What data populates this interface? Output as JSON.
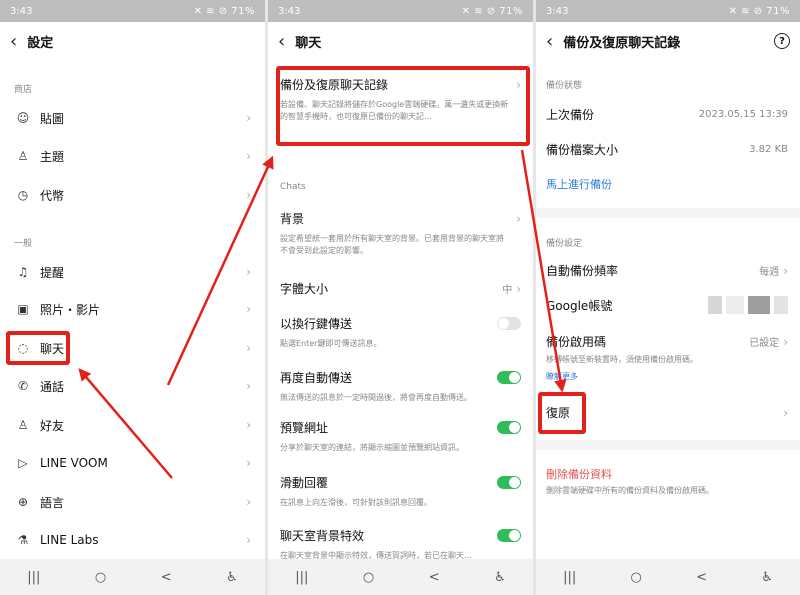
{
  "status": {
    "time": "3:43",
    "icons_left": "▣ G ⋈ •",
    "icons_right": "✕ ≋ ⊘ 71%"
  },
  "panel1": {
    "header_title": "設定",
    "section_shop": "商店",
    "shop_items": [
      {
        "icon": "☺",
        "label": "貼圖"
      },
      {
        "icon": "♙",
        "label": "主題"
      },
      {
        "icon": "◷",
        "label": "代幣"
      }
    ],
    "section_general": "一般",
    "general_items": [
      {
        "icon": "♫",
        "label": "提醒"
      },
      {
        "icon": "▣",
        "label": "照片・影片"
      },
      {
        "icon": "◌",
        "label": "聊天"
      },
      {
        "icon": "✆",
        "label": "通話"
      },
      {
        "icon": "♙",
        "label": "好友"
      },
      {
        "icon": "▷",
        "label": "LINE VOOM"
      },
      {
        "icon": "⊕",
        "label": "語言"
      },
      {
        "icon": "⚗",
        "label": "LINE Labs"
      }
    ]
  },
  "panel2": {
    "header_title": "聊天",
    "backup_title": "備份及復原聊天記錄",
    "backup_desc": "若設備、聊天記錄將儲存於Google雲端硬碟。萬一遺失或更換新的智慧手機時，也可復原已備份的聊天記...",
    "section_chats": "Chats",
    "settings": [
      {
        "title": "背景",
        "desc": "設定希望統一套用於所有聊天室的背景。已套用背景的聊天室將不會受到此設定的影響。",
        "control": "chevron"
      },
      {
        "title": "字體大小",
        "value": "中",
        "control": "chevron"
      },
      {
        "title": "以換行鍵傳送",
        "desc": "點選Enter鍵即可傳送訊息。",
        "control": "toggle-off"
      },
      {
        "title": "再度自動傳送",
        "desc": "無法傳送的訊息於一定時間過後，將會再度自動傳送。",
        "control": "toggle-on"
      },
      {
        "title": "預覽網址",
        "desc": "分享於聊天室的連結，將顯示縮圖並預覽網站資訊。",
        "control": "toggle-on"
      },
      {
        "title": "滑動回覆",
        "desc": "在訊息上向左滑後，可針對該則訊息回覆。",
        "control": "toggle-on"
      },
      {
        "title": "聊天室背景特效",
        "desc": "在聊天室背景中顯示特效，傳送賀詞時，若已在聊天...",
        "control": "toggle-on"
      }
    ]
  },
  "panel3": {
    "header_title": "備份及復原聊天記錄",
    "help": "?",
    "section_status": "備份狀態",
    "last_backup_label": "上次備份",
    "last_backup_value": "2023.05.15 13:39",
    "file_size_label": "備份檔案大小",
    "file_size_value": "3.82 KB",
    "backup_now": "馬上進行備份",
    "section_settings": "備份設定",
    "freq_label": "自動備份頻率",
    "freq_value": "每週",
    "google_label": "Google帳號",
    "pin_label": "備份啟用碼",
    "pin_value": "已設定",
    "pin_desc": "移轉帳號至新裝置時，須使用備份啟用碼。",
    "learn_more": "瞭解更多",
    "restore": "復原",
    "delete_label": "刪除備份資料",
    "delete_desc": "刪除雲端硬碟中所有的備份資料及備份啟用碼。"
  },
  "nav": {
    "recent": "|||",
    "home": "○",
    "back": "<",
    "access": "♿"
  },
  "colors": {
    "highlight": "#e3211a",
    "toggle_on": "#2ebd59"
  }
}
